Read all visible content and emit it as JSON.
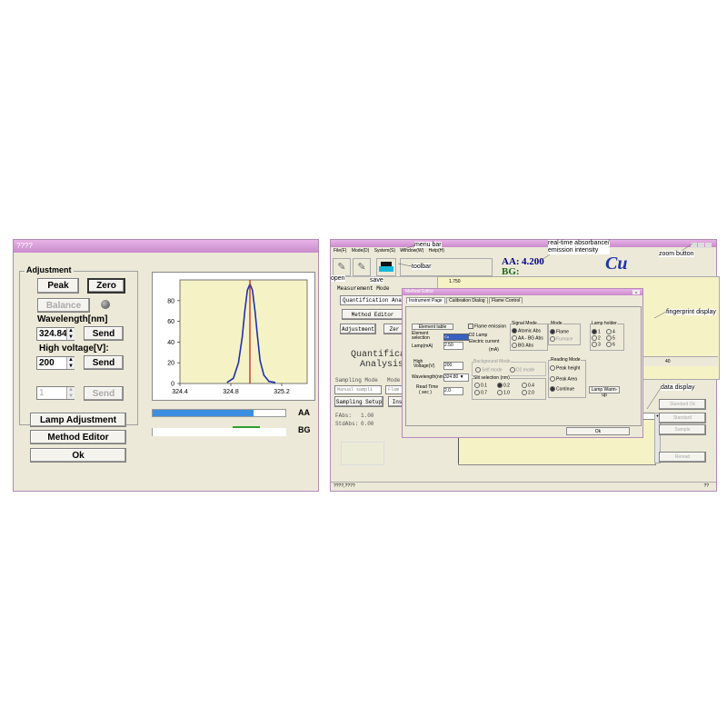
{
  "left": {
    "title": "????",
    "adjustment": {
      "group_label": "Adjustment",
      "peak": "Peak",
      "zero": "Zero",
      "balance": "Balance",
      "wavelength_label": "Wavelength[nm]",
      "wavelength_value": "324.84",
      "send": "Send",
      "voltage_label": "High voltage[V]:",
      "voltage_value": "200",
      "third_value": "1",
      "send_disabled": "Send"
    },
    "lamp_adjustment": "Lamp Adjustment",
    "method_editor": "Method Editor",
    "ok": "Ok",
    "aa_label": "AA",
    "bg_label": "BG",
    "aa_level": 0.76,
    "bg_level": 0.2,
    "colors": {
      "aa": "#3c8fe0",
      "bg": "#2e9e2e",
      "plot_bg": "#f5f2c6",
      "curve": "#1f2fb0",
      "marker": "#c0392b"
    }
  },
  "chart_data": {
    "type": "line",
    "x_ticks": [
      "324.4",
      "324.8",
      "325.2"
    ],
    "y_ticks": [
      "0",
      "20",
      "40",
      "60",
      "80"
    ],
    "xlim": [
      324.4,
      325.4
    ],
    "ylim": [
      0,
      100
    ],
    "marker_x": 324.95,
    "series": [
      {
        "x": [
          324.77,
          324.82,
          324.86,
          324.89,
          324.91,
          324.93,
          324.95,
          324.97,
          324.99,
          325.01,
          325.03,
          325.06,
          325.1,
          325.15
        ],
        "values": [
          1,
          5,
          20,
          45,
          70,
          90,
          96,
          90,
          70,
          45,
          22,
          8,
          2,
          1
        ]
      }
    ]
  },
  "right": {
    "window_title": "",
    "menu": [
      "File(F)",
      "Mode(D)",
      "System(S)",
      "Window(W)",
      "Help(H)"
    ],
    "aa_label": "AA:",
    "aa_value": "4.200",
    "bg_label": "BG:",
    "element": "Cu",
    "measurement_mode_label": "Measurement Mode",
    "measurement_mode_value": "Quantification Analy",
    "method_editor": "Method Editor",
    "adjustment": "Adjustment",
    "zero_partial": "Zer",
    "mode_text_line1": "Quantificat",
    "mode_text_line2": "Analysis",
    "sampling_mode_label": "Sampling Mode",
    "mode_label": "Mode",
    "sampling_value": "Manual sampli",
    "flame_value": "Flam",
    "sampling_setup": "Sampling Setup",
    "ins_partial": "Ins",
    "abs_label": "FAbs:",
    "abs_value": "1.00",
    "std_abs_label": "StdAbs:",
    "std_abs_value": "0.00",
    "chart_top_value": "1.750",
    "chart_x_value": "40",
    "standard_ok": "Standard Ok",
    "standard": "Standard",
    "sample": "Sample",
    "reread": "Reread",
    "status_left": "????,????",
    "status_right": "??"
  },
  "callouts": {
    "menu_bar": "menu bar",
    "realtime": "real-time absorbance/\nemission intensity",
    "zoom_button": "zoom button",
    "toolbar": "toolbar",
    "open": "open",
    "save": "save",
    "fingerprint": "fingerprint display",
    "data_display": "data display"
  },
  "dialog": {
    "title": "Method Editor",
    "tabs": [
      "Instrument Page",
      "Calibration Dialog",
      "Flame Control"
    ],
    "element_table": "Element table",
    "element_selection": "Element selection",
    "element_value": "Cu",
    "flame_emission": "Flame emission",
    "d2_lamp": "D2 Lamp",
    "electric_current": "Electric current",
    "ma_unit": "(mA)",
    "lamp_label": "Lamp(mA)",
    "lamp_value": "2.50",
    "signal_mode_label": "Signal Mode",
    "signal_modes": [
      "Atomic Abs",
      "AA - BG Abs",
      "BG Abs"
    ],
    "mode_label": "Mode",
    "modes": [
      "Flame",
      "Furnace"
    ],
    "lamp_holder_label": "Lamp holder",
    "lamp_holders": [
      "1",
      "4",
      "2",
      "5",
      "3",
      "6"
    ],
    "high_voltage_label": "High Voltage(V)",
    "high_voltage_value": "200",
    "background_mode_label": "Background Mode",
    "background_modes": [
      "Self mode",
      "D2 mode"
    ],
    "wavelength_label": "Wavelength(nm)",
    "wavelength_value": "324.80",
    "slit_label": "Slit selection (nm)",
    "slits": [
      "0.1",
      "0.2",
      "0.4",
      "0.7",
      "1.0",
      "2.0"
    ],
    "read_time_label": "Read Time",
    "read_time_unit": "( sec )",
    "read_time_value": "2.0",
    "reading_mode_label": "Reading Mode",
    "reading_modes": [
      "Peak height",
      "Peak Area",
      "Continue"
    ],
    "lamp_warmup": "Lamp Warm-up",
    "ok": "Ok"
  }
}
